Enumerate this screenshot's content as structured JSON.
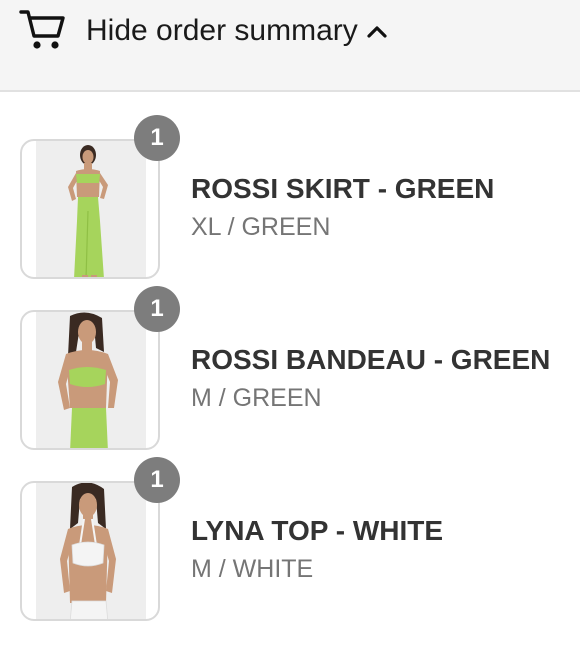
{
  "header": {
    "toggle_label": "Hide order summary",
    "cart_icon": "cart-icon",
    "chevron_icon": "chevron-up-icon"
  },
  "colors": {
    "header_bg": "#f5f5f5",
    "badge_bg": "#7d7d7d",
    "green_garment": "#a6d45c",
    "white_garment": "#f4f4f4"
  },
  "items": [
    {
      "quantity": "1",
      "name": "ROSSI SKIRT - GREEN",
      "variant": "XL / GREEN"
    },
    {
      "quantity": "1",
      "name": "ROSSI BANDEAU - GREEN",
      "variant": "M / GREEN"
    },
    {
      "quantity": "1",
      "name": "LYNA TOP - WHITE",
      "variant": "M / WHITE"
    }
  ]
}
